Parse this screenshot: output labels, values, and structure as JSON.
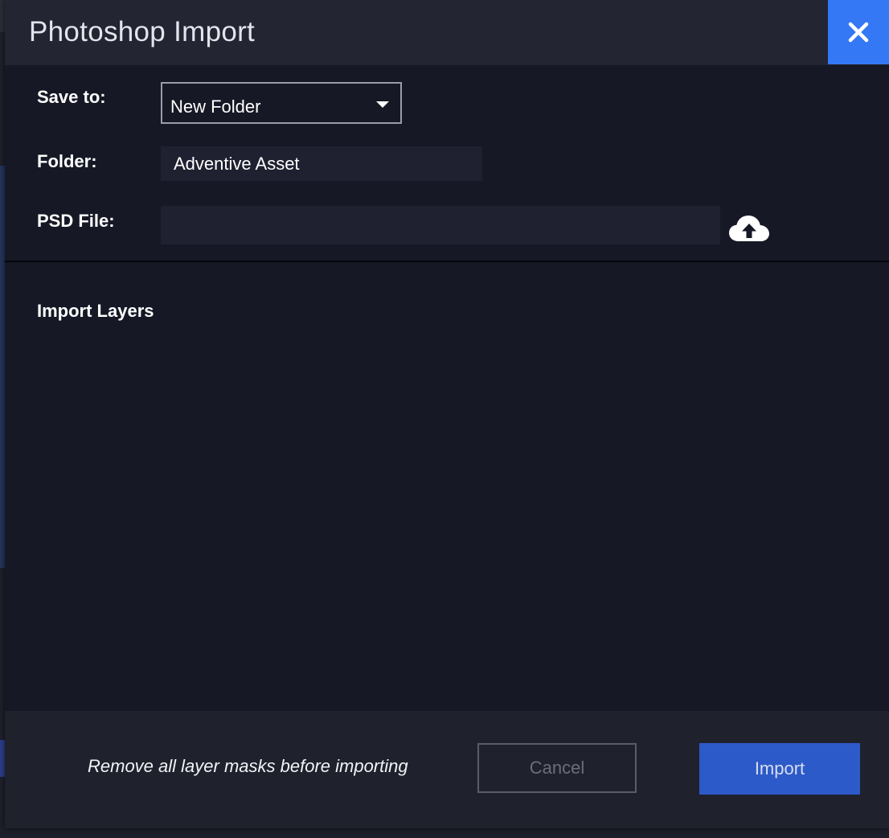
{
  "dialog": {
    "title": "Photoshop Import",
    "close_icon": "close-icon",
    "accent_color": "#3478f6"
  },
  "form": {
    "save_to": {
      "label": "Save to:",
      "selected": "New Folder"
    },
    "folder": {
      "label": "Folder:",
      "value": "Adventive Asset"
    },
    "psd_file": {
      "label": "PSD File:",
      "value": "",
      "upload_icon": "cloud-upload-icon"
    }
  },
  "import_layers": {
    "title": "Import Layers"
  },
  "footer": {
    "note": "Remove all layer masks before importing",
    "cancel_label": "Cancel",
    "import_label": "Import",
    "import_color": "#2d5ac9"
  }
}
